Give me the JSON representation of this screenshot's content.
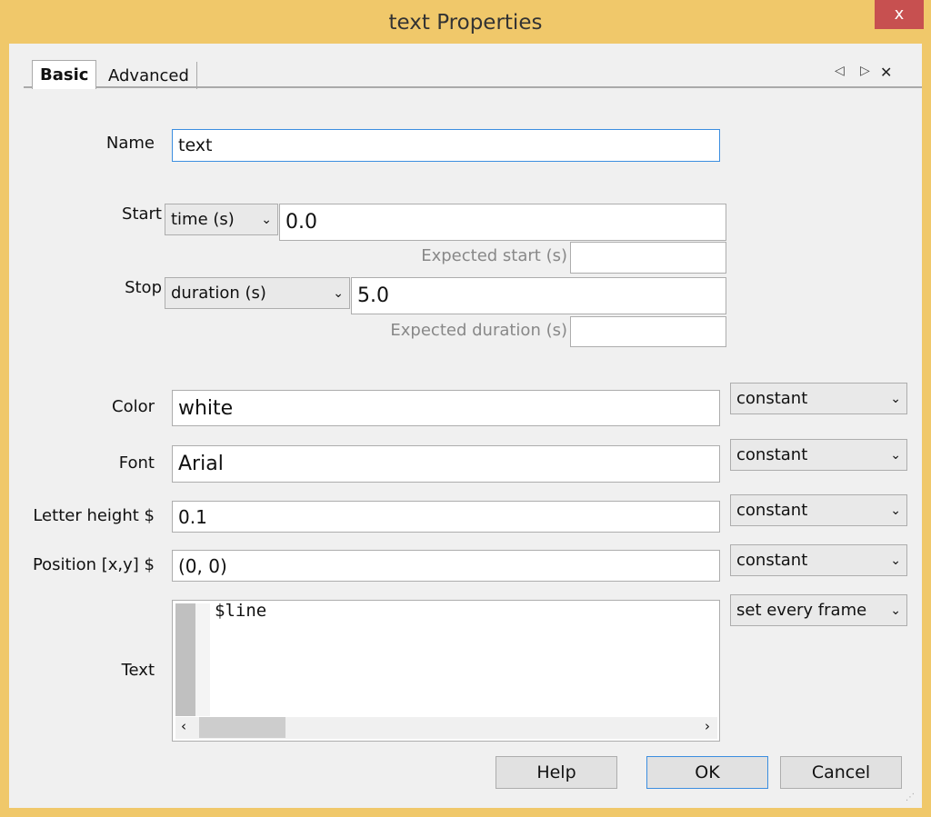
{
  "window": {
    "title": "text Properties",
    "close": "x"
  },
  "tabs": [
    {
      "label": "Basic"
    },
    {
      "label": "Advanced"
    }
  ],
  "tab_nav": {
    "prev": "◁",
    "next": "▷",
    "close": "✕"
  },
  "fields": {
    "name": {
      "label": "Name",
      "value": "text"
    },
    "start": {
      "label": "Start",
      "type": "time (s)",
      "value": "0.0",
      "expected_label": "Expected start (s)",
      "expected_value": ""
    },
    "stop": {
      "label": "Stop",
      "type": "duration (s)",
      "value": "5.0",
      "expected_label": "Expected duration (s)",
      "expected_value": ""
    },
    "color": {
      "label": "Color",
      "value": "white",
      "mode": "constant"
    },
    "font": {
      "label": "Font",
      "value": "Arial",
      "mode": "constant"
    },
    "letter_height": {
      "label": "Letter height $",
      "value": "0.1",
      "mode": "constant"
    },
    "position": {
      "label": "Position [x,y] $",
      "value": "(0, 0)",
      "mode": "constant"
    },
    "text": {
      "label": "Text",
      "value": "$line",
      "mode": "set every frame"
    }
  },
  "buttons": {
    "help": "Help",
    "ok": "OK",
    "cancel": "Cancel"
  }
}
